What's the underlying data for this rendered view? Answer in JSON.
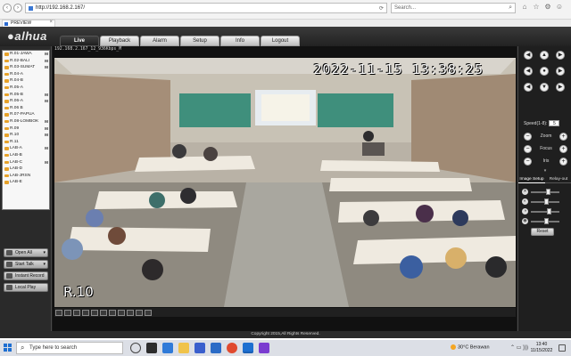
{
  "browser": {
    "url": "http://192.168.2.167/",
    "search_placeholder": "Search...",
    "tab_title": "PREVIEW",
    "tab_close": "×",
    "back_glyph": "‹",
    "forward_glyph": "›",
    "go_glyph": "⟳"
  },
  "app": {
    "logo": "alhua",
    "logo_prefix": "●",
    "tabs": [
      "Live",
      "Playback",
      "Alarm",
      "Setup",
      "Info",
      "Logout"
    ],
    "active_tab": "Live"
  },
  "channels": [
    {
      "label": "R.01-JAWA",
      "flag": "M"
    },
    {
      "label": "R.02-BALI",
      "flag": "M"
    },
    {
      "label": "R.03-SUMAT",
      "flag": "M"
    },
    {
      "label": "R.04-A",
      "flag": ""
    },
    {
      "label": "R.04-B",
      "flag": ""
    },
    {
      "label": "R.05-A",
      "flag": ""
    },
    {
      "label": "R.05-B",
      "flag": "M"
    },
    {
      "label": "R.06-A",
      "flag": "M"
    },
    {
      "label": "R.06 B",
      "flag": ""
    },
    {
      "label": "R.07-PAPUA",
      "flag": ""
    },
    {
      "label": "R.08-LOMBOK",
      "flag": "M"
    },
    {
      "label": "R.09",
      "flag": "M"
    },
    {
      "label": "R.10",
      "flag": "M"
    },
    {
      "label": "R.11",
      "flag": ""
    },
    {
      "label": "LAB-A",
      "flag": "M"
    },
    {
      "label": "LAB-B",
      "flag": ""
    },
    {
      "label": "LAB-C",
      "flag": "M"
    },
    {
      "label": "LAB-D",
      "flag": ""
    },
    {
      "label": "LAB-JRSN",
      "flag": ""
    },
    {
      "label": "LAB-E",
      "flag": ""
    }
  ],
  "side_buttons": {
    "open_all": "Open All",
    "start_talk": "Start Talk",
    "instant_record": "Instant Record",
    "local_play": "Local Play",
    "chevron": "▾"
  },
  "video": {
    "info": "192.168.2.167_12_936Kbps_M",
    "timestamp": "2022-11-15 13:38:25",
    "channel_name": "R.10"
  },
  "ptz": {
    "speed_label": "Speed(1-8):",
    "speed_value": "5",
    "zoom": "Zoom",
    "focus": "Focus",
    "iris": "Iris",
    "minus": "−",
    "plus": "+",
    "arrow_up": "▲",
    "arrow_down": "▼",
    "arrow_left": "◀",
    "arrow_right": "▶",
    "center": "●",
    "divider": "▾"
  },
  "setup_panel": {
    "image_setup": "Image Setup",
    "relay_out": "Relay-out",
    "reset": "Reset",
    "slider_levels": [
      0.55,
      0.5,
      0.6,
      0.5
    ],
    "slider_glyphs": [
      "☀",
      "◐",
      "◑",
      "◉"
    ]
  },
  "footer": {
    "copyright": "Copyright 2015,All Rights Reserved."
  },
  "taskbar": {
    "search_placeholder": "Type here to search",
    "search_glyph": "⌕",
    "weather_temp": "30°C",
    "weather_text": "Berawan",
    "tray": "⌃ ▭ ))) ",
    "time": "13:40",
    "date": "11/15/2022"
  },
  "colors": {
    "accent_tab": "#1e1e1e",
    "channel_icon": "#e7a22a"
  }
}
